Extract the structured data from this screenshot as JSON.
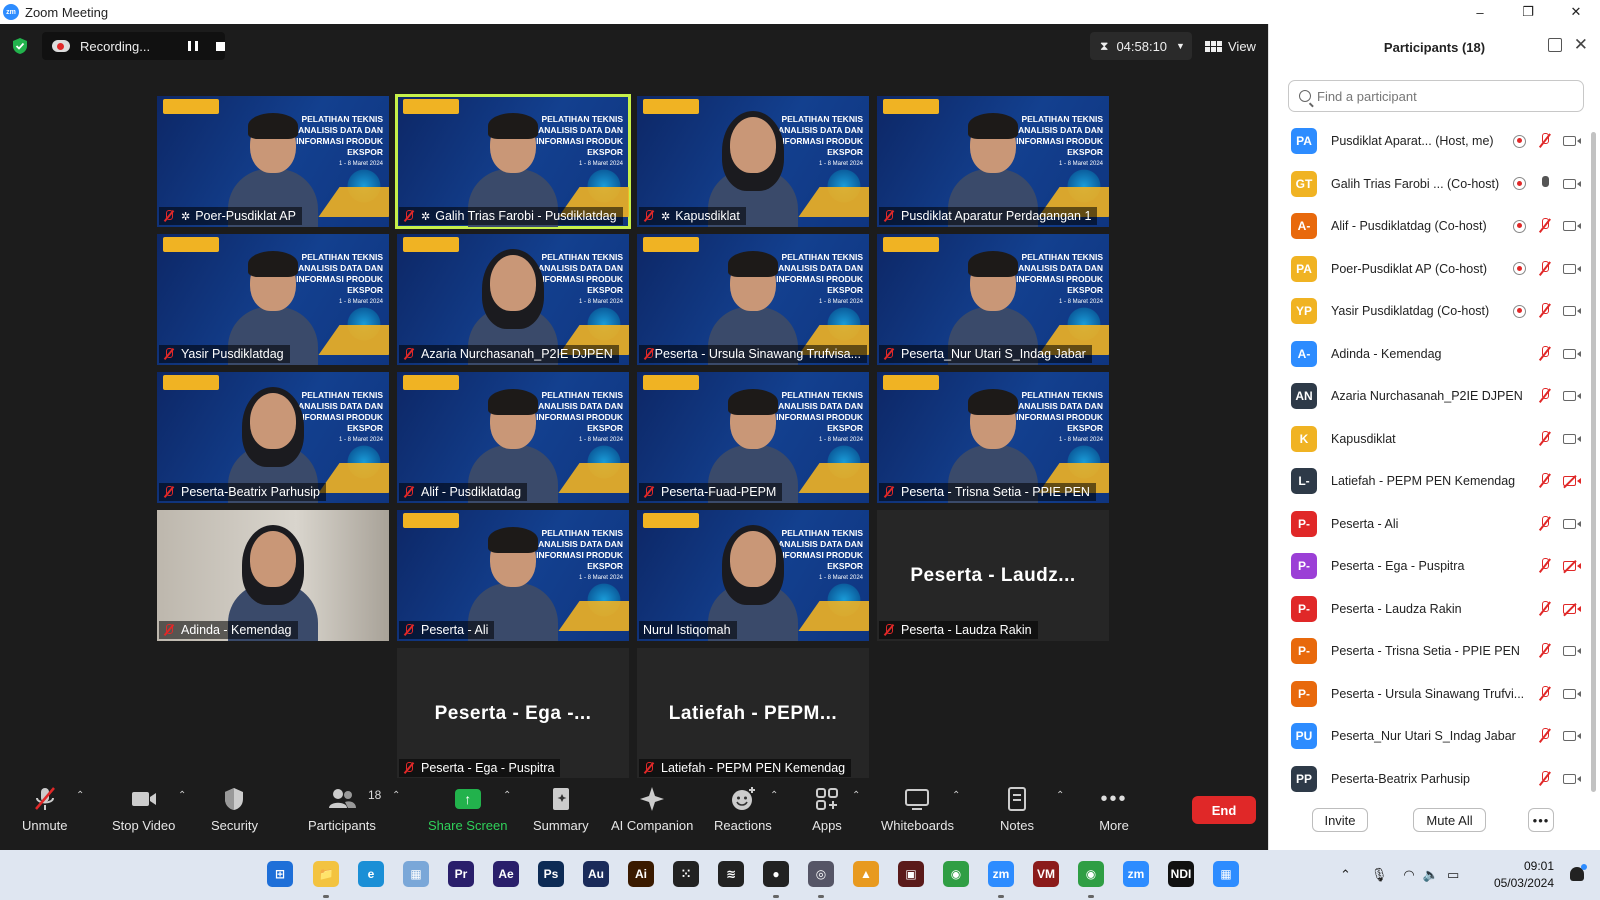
{
  "window": {
    "title": "Zoom Meeting",
    "logo_text": "zm",
    "buttons": [
      "–",
      "❐",
      "✕"
    ]
  },
  "topbar": {
    "recording_label": "Recording...",
    "timer": "04:58:10",
    "view_label": "View"
  },
  "slide_banner": {
    "line1": "PELATIHAN TEKNIS",
    "line2": "ANALISIS DATA DAN",
    "line3": "INFORMASI PRODUK EKSPOR",
    "date": "1 - 8 Maret 2024"
  },
  "tiles": [
    {
      "name": "Poer-Pusdiklat AP",
      "pinned": true
    },
    {
      "name": "Galih Trias Farobi - Pusdiklatdag",
      "pinned": true,
      "active": true
    },
    {
      "name": "Kapusdiklat",
      "pinned": true
    },
    {
      "name": "Pusdiklat Aparatur Perdagangan 1"
    },
    {
      "name": "Yasir Pusdiklatdag"
    },
    {
      "name": "Azaria Nurchasanah_P2IE DJPEN"
    },
    {
      "name": "Peserta - Ursula Sinawang Trufvisa..."
    },
    {
      "name": "Peserta_Nur Utari S_Indag Jabar"
    },
    {
      "name": "Peserta-Beatrix Parhusip"
    },
    {
      "name": "Alif - Pusdiklatdag"
    },
    {
      "name": "Peserta-Fuad-PEPM"
    },
    {
      "name": "Peserta - Trisna Setia - PPIE PEN"
    },
    {
      "name": "Adinda - Kemendag"
    },
    {
      "name": "Peserta - Ali"
    },
    {
      "name": "Nurul Istiqomah"
    },
    {
      "name": "Peserta - Laudza Rakin",
      "big": "Peserta - Laudz..."
    },
    {
      "name": "Peserta - Ega - Puspitra",
      "big": "Peserta - Ega -..."
    },
    {
      "name": "Latiefah - PEPM PEN Kemendag",
      "big": "Latiefah - PEPM..."
    }
  ],
  "toolbar": {
    "unmute": "Unmute",
    "stop_video": "Stop Video",
    "security": "Security",
    "participants": "Participants",
    "participants_count": "18",
    "share_screen": "Share Screen",
    "summary": "Summary",
    "ai_companion": "AI Companion",
    "reactions": "Reactions",
    "apps": "Apps",
    "whiteboards": "Whiteboards",
    "notes": "Notes",
    "more": "More",
    "end": "End"
  },
  "panel": {
    "title": "Participants (18)",
    "search_placeholder": "Find a participant",
    "invite": "Invite",
    "mute_all": "Mute All",
    "more": "•••",
    "participants": [
      {
        "initials": "PA",
        "color": "#2d8cff",
        "name": "Pusdiklat Aparat...   (Host, me)",
        "rec": true,
        "mic": "off",
        "cam": "on"
      },
      {
        "initials": "GT",
        "color": "#f0b323",
        "name": "Galih Trias Farobi ...  (Co-host)",
        "rec": true,
        "mic": "on",
        "cam": "on"
      },
      {
        "initials": "A-",
        "color": "#e8690c",
        "name": "Alif - Pusdiklatdag (Co-host)",
        "rec": true,
        "mic": "off",
        "cam": "on"
      },
      {
        "initials": "PA",
        "color": "#f0b323",
        "name": "Poer-Pusdiklat AP (Co-host)",
        "rec": true,
        "mic": "off",
        "cam": "on"
      },
      {
        "initials": "YP",
        "color": "#f0b323",
        "name": "Yasir Pusdiklatdag (Co-host)",
        "rec": true,
        "mic": "off",
        "cam": "on"
      },
      {
        "initials": "A-",
        "color": "#2d8cff",
        "name": "Adinda - Kemendag",
        "mic": "off",
        "cam": "on"
      },
      {
        "initials": "AN",
        "color": "#2e3a48",
        "name": "Azaria Nurchasanah_P2IE DJPEN",
        "mic": "off",
        "cam": "on"
      },
      {
        "initials": "K",
        "color": "#f0b323",
        "name": "Kapusdiklat",
        "mic": "off",
        "cam": "on"
      },
      {
        "initials": "L-",
        "color": "#2e3a48",
        "name": "Latiefah - PEPM PEN Kemendag",
        "mic": "off",
        "cam": "off"
      },
      {
        "initials": "P-",
        "color": "#e02828",
        "name": "Peserta - Ali",
        "mic": "off",
        "cam": "on"
      },
      {
        "initials": "P-",
        "color": "#9b3fd6",
        "name": "Peserta - Ega - Puspitra",
        "mic": "off",
        "cam": "off"
      },
      {
        "initials": "P-",
        "color": "#e02828",
        "name": "Peserta - Laudza Rakin",
        "mic": "off",
        "cam": "off"
      },
      {
        "initials": "P-",
        "color": "#e8690c",
        "name": "Peserta - Trisna Setia - PPIE PEN",
        "mic": "off",
        "cam": "on"
      },
      {
        "initials": "P-",
        "color": "#e8690c",
        "name": "Peserta - Ursula Sinawang Trufvi...",
        "mic": "off",
        "cam": "on"
      },
      {
        "initials": "PU",
        "color": "#2d8cff",
        "name": "Peserta_Nur Utari S_Indag Jabar",
        "mic": "off",
        "cam": "on"
      },
      {
        "initials": "PP",
        "color": "#2e3a48",
        "name": "Peserta-Beatrix Parhusip",
        "mic": "off",
        "cam": "on"
      }
    ]
  },
  "taskbar": {
    "apps": [
      {
        "name": "start",
        "label": "⊞",
        "color": "#1e6fd8"
      },
      {
        "name": "file-explorer",
        "label": "📁",
        "color": "#f3c340"
      },
      {
        "name": "edge",
        "label": "e",
        "color": "#1b8fd6"
      },
      {
        "name": "photos",
        "label": "▦",
        "color": "#7aa7d8"
      },
      {
        "name": "premiere",
        "label": "Pr",
        "color": "#2a1f6b"
      },
      {
        "name": "after-effects",
        "label": "Ae",
        "color": "#2a1f6b"
      },
      {
        "name": "photoshop",
        "label": "Ps",
        "color": "#0d2b55"
      },
      {
        "name": "audition",
        "label": "Au",
        "color": "#1a2b5a"
      },
      {
        "name": "illustrator",
        "label": "Ai",
        "color": "#3a1a00"
      },
      {
        "name": "app-dots",
        "label": "⁙",
        "color": "#222"
      },
      {
        "name": "app-wave",
        "label": "≋",
        "color": "#222"
      },
      {
        "name": "obs",
        "label": "●",
        "color": "#222"
      },
      {
        "name": "app-circle",
        "label": "◎",
        "color": "#556"
      },
      {
        "name": "app-chart",
        "label": "▲",
        "color": "#e89a20"
      },
      {
        "name": "app-window",
        "label": "▣",
        "color": "#5a1a1a"
      },
      {
        "name": "chrome",
        "label": "◉",
        "color": "#2f9e44"
      },
      {
        "name": "zoom",
        "label": "zm",
        "color": "#2d8cff"
      },
      {
        "name": "voicemeeter",
        "label": "VM",
        "color": "#8b1b1b"
      },
      {
        "name": "chrome-profile",
        "label": "◉",
        "color": "#2f9e44"
      },
      {
        "name": "zoom-2",
        "label": "zm",
        "color": "#2d8cff"
      },
      {
        "name": "ndi",
        "label": "NDI",
        "color": "#111"
      },
      {
        "name": "app-grid",
        "label": "▦",
        "color": "#2d8cff"
      }
    ],
    "time": "09:01",
    "date": "05/03/2024"
  }
}
